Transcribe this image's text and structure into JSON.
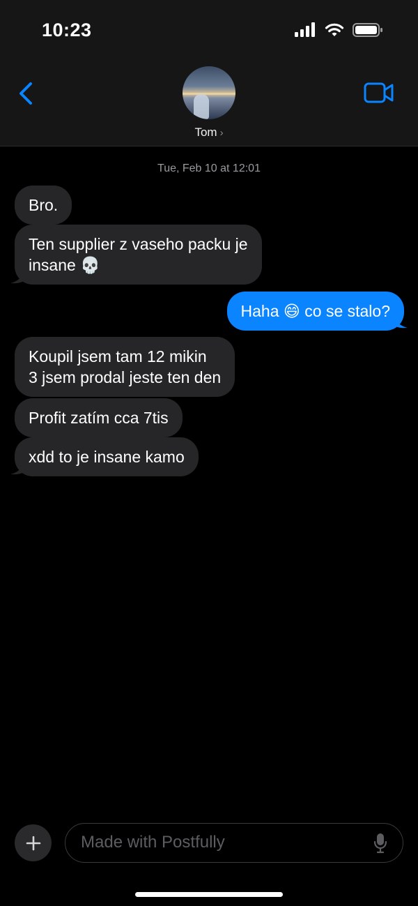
{
  "status_bar": {
    "time": "10:23"
  },
  "header": {
    "contact_name": "Tom",
    "chevron": "›",
    "back_icon": "chevron-left-icon",
    "video_icon": "video-camera-icon",
    "accent_color": "#0a84ff"
  },
  "conversation": {
    "timestamp": "Tue, Feb 10 at 12:01",
    "messages": [
      {
        "direction": "incoming",
        "text": "Bro."
      },
      {
        "direction": "incoming",
        "text": "Ten supplier z vaseho packu je\ninsane 💀"
      },
      {
        "direction": "outgoing",
        "text": "Haha 😄 co se stalo?"
      },
      {
        "direction": "incoming",
        "text": "Koupil jsem tam 12 mikin\n3 jsem prodal jeste ten den"
      },
      {
        "direction": "incoming",
        "text": "Profit zatím cca 7tis"
      },
      {
        "direction": "incoming",
        "text": "xdd to je insane kamo"
      }
    ]
  },
  "composer": {
    "placeholder": "Made with Postfully",
    "plus_icon": "plus-icon",
    "mic_icon": "microphone-icon"
  },
  "colors": {
    "incoming_bubble": "#262628",
    "outgoing_bubble": "#0a84ff",
    "background": "#000000"
  }
}
